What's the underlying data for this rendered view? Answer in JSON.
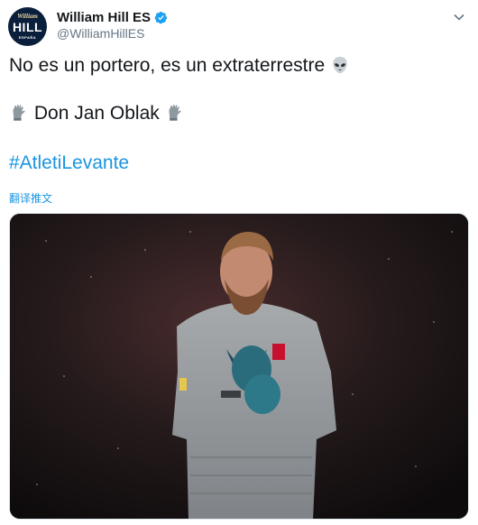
{
  "tweet": {
    "author": {
      "display_name": "William Hill ES",
      "handle": "@WilliamHillES",
      "avatar": {
        "brand_text": "William",
        "main_text": "HILL",
        "sub_text": "ESPAÑA",
        "color": "#0a1f3b"
      },
      "verified": true
    },
    "text_line1": "No es un portero, es un extraterrestre",
    "text_line2": "Don Jan Oblak",
    "hashtag": "#AtletiLevante",
    "translate_label": "翻译推文",
    "icons": {
      "alien": "alien-emoji",
      "gloves": "glove-emoji",
      "verified": "verified-badge-icon",
      "more": "chevron-down-icon"
    },
    "colors": {
      "link": "#1b95e0",
      "muted": "#657786",
      "text": "#14171a"
    }
  }
}
